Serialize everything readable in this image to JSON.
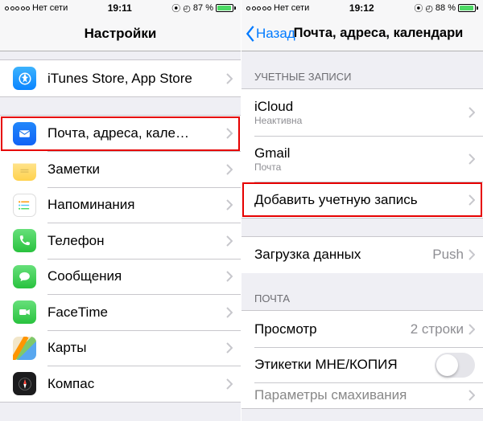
{
  "left": {
    "status": {
      "carrier": "Нет сети",
      "time": "19:11",
      "batteryPct": "87 %",
      "batteryFill": 87
    },
    "title": "Настройки",
    "rows": {
      "itunes": "iTunes Store, App Store",
      "mail": "Почта, адреса, кале…",
      "notes": "Заметки",
      "reminders": "Напоминания",
      "phone": "Телефон",
      "messages": "Сообщения",
      "facetime": "FaceTime",
      "maps": "Карты",
      "compass": "Компас"
    }
  },
  "right": {
    "status": {
      "carrier": "Нет сети",
      "time": "19:12",
      "batteryPct": "88 %",
      "batteryFill": 88
    },
    "back": "Назад",
    "title": "Почта, адреса, календари",
    "headers": {
      "accounts": "Учетные записи",
      "mail": "Почта"
    },
    "accounts": {
      "icloud": {
        "name": "iCloud",
        "sub": "Неактивна"
      },
      "gmail": {
        "name": "Gmail",
        "sub": "Почта"
      },
      "add": "Добавить учетную запись"
    },
    "fetch": {
      "label": "Загрузка данных",
      "value": "Push"
    },
    "preview": {
      "label": "Просмотр",
      "value": "2 строки"
    },
    "labels": "Этикетки МНЕ/КОПИЯ",
    "swipe": "Параметры смахивания"
  }
}
